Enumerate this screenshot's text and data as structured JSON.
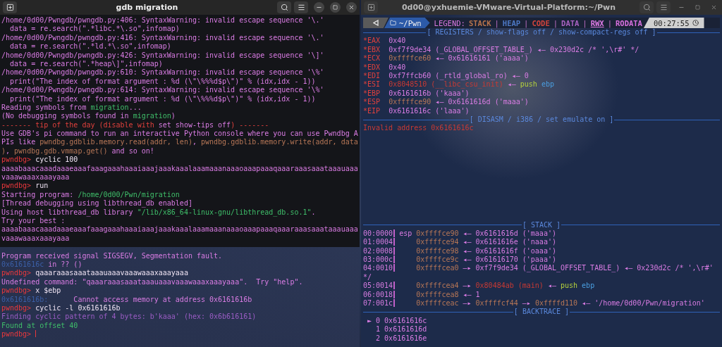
{
  "left_terminal": {
    "title": "gdb migration",
    "focused": true,
    "has_cursor": true,
    "lines": [
      {
        "kind": "output",
        "segments": [
          {
            "kind": "t",
            "text": "/home/0d00/Pwngdb/pwngdb.py:406: SyntaxWarning: invalid escape sequence '\\.'"
          }
        ]
      },
      {
        "kind": "output",
        "segments": [
          {
            "kind": "t",
            "text": "  data = re.search(\".*libc.*\\.so\",infomap)"
          }
        ]
      },
      {
        "kind": "output",
        "segments": [
          {
            "kind": "t",
            "text": "/home/0d00/Pwngdb/pwngdb.py:416: SyntaxWarning: invalid escape sequence '\\.'"
          }
        ]
      },
      {
        "kind": "output",
        "segments": [
          {
            "kind": "t",
            "text": "  data = re.search(\".*ld.*\\.so\",infomap)"
          }
        ]
      },
      {
        "kind": "output",
        "segments": [
          {
            "kind": "t",
            "text": "/home/0d00/Pwngdb/pwngdb.py:426: SyntaxWarning: invalid escape sequence '\\]'"
          }
        ]
      },
      {
        "kind": "output",
        "segments": [
          {
            "kind": "t",
            "text": "  data = re.search(\".*heap\\]\",infomap)"
          }
        ]
      },
      {
        "kind": "output",
        "segments": [
          {
            "kind": "t",
            "text": "/home/0d00/Pwngdb/pwngdb.py:610: SyntaxWarning: invalid escape sequence '\\%'"
          }
        ]
      },
      {
        "kind": "output",
        "segments": [
          {
            "kind": "t",
            "text": "  print(\"The index of format argument : %d (\\\"\\%%%d$p\\\")\" % (idx,idx - 1))"
          }
        ]
      },
      {
        "kind": "output",
        "segments": [
          {
            "kind": "t",
            "text": "/home/0d00/Pwngdb/pwngdb.py:614: SyntaxWarning: invalid escape sequence '\\%'"
          }
        ]
      },
      {
        "kind": "output",
        "segments": [
          {
            "kind": "t",
            "text": "  print(\"The index of format argument : %d (\\\"\\%%%d$p\\\")\" % (idx,idx - 1))"
          }
        ]
      },
      {
        "kind": "output",
        "segments": [
          {
            "kind": "t",
            "text": "Reading symbols from "
          },
          {
            "kind": "g",
            "text": "migration"
          },
          {
            "kind": "t",
            "text": "..."
          }
        ]
      },
      {
        "kind": "output",
        "segments": [
          {
            "kind": "t",
            "text": "(No debugging symbols found in "
          },
          {
            "kind": "g",
            "text": "migration"
          },
          {
            "kind": "t",
            "text": ")"
          }
        ]
      },
      {
        "kind": "output",
        "segments": [
          {
            "kind": "r",
            "text": "------- tip of the day (disable with "
          },
          {
            "kind": "t",
            "text": "set show-tips off"
          },
          {
            "kind": "r",
            "text": ") -------"
          }
        ]
      },
      {
        "kind": "output",
        "segments": [
          {
            "kind": "t",
            "text": "Use GDB's pi command to run an interactive Python console where you can use Pwndbg A"
          }
        ]
      },
      {
        "kind": "output",
        "segments": [
          {
            "kind": "t",
            "text": "PIs like "
          },
          {
            "kind": "o",
            "text": "pwndbg.gdblib.memory.read(addr, len)"
          },
          {
            "kind": "t",
            "text": ", "
          },
          {
            "kind": "o",
            "text": "pwndbg.gdblib.memory.write(addr, data"
          }
        ]
      },
      {
        "kind": "output",
        "segments": [
          {
            "kind": "o",
            "text": ")"
          },
          {
            "kind": "t",
            "text": ", "
          },
          {
            "kind": "o",
            "text": "pwndbg.gdb.vmmap.get()"
          },
          {
            "kind": "t",
            "text": " and so on!"
          }
        ]
      },
      {
        "kind": "output",
        "segments": [
          {
            "kind": "p",
            "text": "pwndbg> "
          },
          {
            "kind": "w",
            "text": "cyclic 100"
          }
        ]
      },
      {
        "kind": "output",
        "segments": [
          {
            "kind": "t",
            "text": "aaaabaaacaaadaaaeaaafaaagaaahaaaiaaajaaakaaalaaamaaanaaaoaaapaaaqaaaraaasaaataaauaaa"
          }
        ]
      },
      {
        "kind": "output",
        "segments": [
          {
            "kind": "t",
            "text": "vaaawaaaxaaayaaa"
          }
        ]
      },
      {
        "kind": "output",
        "segments": [
          {
            "kind": "p",
            "text": "pwndbg> "
          },
          {
            "kind": "w",
            "text": "run"
          }
        ]
      },
      {
        "kind": "output",
        "segments": [
          {
            "kind": "t",
            "text": "Starting program: "
          },
          {
            "kind": "g",
            "text": "/home/0d00/Pwn/migration"
          }
        ]
      },
      {
        "kind": "output",
        "segments": [
          {
            "kind": "t",
            "text": "[Thread debugging using libthread_db enabled]"
          }
        ]
      },
      {
        "kind": "output",
        "segments": [
          {
            "kind": "t",
            "text": "Using host libthread_db library "
          },
          {
            "kind": "g",
            "text": "\"/lib/x86_64-linux-gnu/libthread_db.so.1\""
          },
          {
            "kind": "t",
            "text": "."
          }
        ]
      },
      {
        "kind": "output",
        "segments": [
          {
            "kind": "t",
            "text": "Try your best :"
          }
        ]
      },
      {
        "kind": "output",
        "segments": [
          {
            "kind": "t",
            "text": "aaaabaaacaaadaaaeaaafaaagaaahaaaiaaajaaakaaalaaamaaanaaaoaaapaaaqaaaraaasaaataaauaaa"
          }
        ]
      },
      {
        "kind": "output",
        "segments": [
          {
            "kind": "t",
            "text": "vaaawaaaxaaayaaa"
          }
        ]
      },
      {
        "kind": "blank"
      },
      {
        "kind": "output",
        "segments": [
          {
            "kind": "t",
            "text": "Program received signal SIGSEGV, Segmentation fault."
          }
        ]
      },
      {
        "kind": "output",
        "segments": [
          {
            "kind": "b",
            "text": "0x6161616c"
          },
          {
            "kind": "t",
            "text": " in ?? ()"
          }
        ]
      },
      {
        "kind": "output",
        "segments": [
          {
            "kind": "p",
            "text": "pwndbg> "
          },
          {
            "kind": "w",
            "text": "qaaaraaasaaataaauaaavaaawaaaxaaayaaa"
          }
        ]
      },
      {
        "kind": "output",
        "segments": [
          {
            "kind": "t",
            "text": "Undefined command: \"qaaaraaasaaataaauaaavaaawaaaxaaayaaa\".  Try \"help\"."
          }
        ]
      },
      {
        "kind": "output",
        "segments": [
          {
            "kind": "p",
            "text": "pwndbg> "
          },
          {
            "kind": "w",
            "text": "x $ebp"
          }
        ]
      },
      {
        "kind": "output",
        "segments": [
          {
            "kind": "b",
            "text": "0x6161616b:"
          },
          {
            "kind": "t",
            "text": "      Cannot access memory at address 0x6161616b"
          }
        ]
      },
      {
        "kind": "output",
        "segments": [
          {
            "kind": "p",
            "text": "pwndbg> "
          },
          {
            "kind": "w",
            "text": "cyclic -l 0x6161616b"
          }
        ]
      },
      {
        "kind": "output",
        "segments": [
          {
            "kind": "v",
            "text": "Finding cyclic pattern of 4 bytes: b'kaaa' (hex: 0x6b616161)"
          }
        ]
      },
      {
        "kind": "output",
        "segments": [
          {
            "kind": "g",
            "text": "Found at offset 40"
          }
        ]
      },
      {
        "kind": "output",
        "segments": [
          {
            "kind": "p",
            "text": "pwndbg> "
          }
        ]
      }
    ]
  },
  "right_terminal": {
    "title": "0d00@yxhuemie-VMware-Virtual-Platform:~/Pwn",
    "focused": false,
    "status_bar": {
      "path": "~/Pwn",
      "legend_label": "LEGEND:",
      "separator": "|",
      "time": "00:27:55",
      "legend": [
        {
          "label": "STACK",
          "color": "#b8744c",
          "underlined": false
        },
        {
          "label": "HEAP",
          "color": "#4d78c4",
          "underlined": false
        },
        {
          "label": "CODE",
          "color": "#d0443c",
          "underlined": false
        },
        {
          "label": "DATA",
          "color": "#a862c0",
          "underlined": false
        },
        {
          "label": "RWX",
          "color": "#e07ce8",
          "underlined": true
        },
        {
          "label": "RODATA",
          "color": "#d870e0",
          "underlined": false
        }
      ]
    },
    "top_lines": [
      {
        "kind": "header",
        "title": "[ REGISTERS / show-flags off / show-compact-regs off ]"
      },
      {
        "kind": "output",
        "segments": [
          {
            "kind": "r",
            "text": "*EAX"
          },
          {
            "kind": "t",
            "text": "  0x40"
          }
        ]
      },
      {
        "kind": "output",
        "segments": [
          {
            "kind": "r",
            "text": "*EBX"
          },
          {
            "kind": "t",
            "text": "  0xf7f9de34 (_GLOBAL_OFFSET_TABLE_) ◂— 0x230d2c /* ',\\r#' */"
          }
        ]
      },
      {
        "kind": "output",
        "segments": [
          {
            "kind": "r",
            "text": "*ECX"
          },
          {
            "kind": "o",
            "text": "  0xffffce60"
          },
          {
            "kind": "t",
            "text": " ◂— 0x61616161 ('aaaa')"
          }
        ]
      },
      {
        "kind": "output",
        "segments": [
          {
            "kind": "r",
            "text": "*EDX"
          },
          {
            "kind": "t",
            "text": "  0x40"
          }
        ]
      },
      {
        "kind": "output",
        "segments": [
          {
            "kind": "r",
            "text": "*EDI"
          },
          {
            "kind": "t",
            "text": "  0xf7ffcb60 (_rtld_global_ro) ◂— 0"
          }
        ]
      },
      {
        "kind": "output",
        "segments": [
          {
            "kind": "r",
            "text": "*ESI"
          },
          {
            "kind": "k",
            "text": "  0x8048510 (__libc_csu_init)"
          },
          {
            "kind": "t",
            "text": " ◂— "
          },
          {
            "kind": "y",
            "text": "push "
          },
          {
            "kind": "c",
            "text": "ebp"
          }
        ]
      },
      {
        "kind": "output",
        "segments": [
          {
            "kind": "r",
            "text": "*EBP"
          },
          {
            "kind": "t",
            "text": "  0x6161616b ('kaaa')"
          }
        ]
      },
      {
        "kind": "output",
        "segments": [
          {
            "kind": "r",
            "text": "*ESP"
          },
          {
            "kind": "o",
            "text": "  0xffffce90"
          },
          {
            "kind": "t",
            "text": " ◂— 0x6161616d ('maaa')"
          }
        ]
      },
      {
        "kind": "output",
        "segments": [
          {
            "kind": "r",
            "text": "*EIP"
          },
          {
            "kind": "t",
            "text": "  0x6161616c ('laaa')"
          }
        ]
      },
      {
        "kind": "header",
        "title": "[ DISASM / i386 / set emulate on ]"
      },
      {
        "kind": "output",
        "segments": [
          {
            "kind": "k",
            "text": "Invalid address 0x6161616c"
          }
        ]
      }
    ],
    "bottom_lines": [
      {
        "kind": "header",
        "title": "[ STACK ]"
      },
      {
        "kind": "output",
        "segments": [
          {
            "kind": "n",
            "text": "00:0000"
          },
          {
            "kind": "t",
            "text": " esp "
          },
          {
            "kind": "o",
            "text": "0xffffce90"
          },
          {
            "kind": "t",
            "text": " ◂— 0x6161616d ('maaa')"
          }
        ]
      },
      {
        "kind": "output",
        "segments": [
          {
            "kind": "n",
            "text": "01:0004"
          },
          {
            "kind": "o",
            "text": "     0xffffce94"
          },
          {
            "kind": "t",
            "text": " ◂— 0x6161616e ('naaa')"
          }
        ]
      },
      {
        "kind": "output",
        "segments": [
          {
            "kind": "n",
            "text": "02:0008"
          },
          {
            "kind": "o",
            "text": "     0xffffce98"
          },
          {
            "kind": "t",
            "text": " ◂— 0x6161616f ('oaaa')"
          }
        ]
      },
      {
        "kind": "output",
        "segments": [
          {
            "kind": "n",
            "text": "03:000c"
          },
          {
            "kind": "o",
            "text": "     0xffffce9c"
          },
          {
            "kind": "t",
            "text": " ◂— 0x61616170 ('paaa')"
          }
        ]
      },
      {
        "kind": "output",
        "segments": [
          {
            "kind": "n",
            "text": "04:0010"
          },
          {
            "kind": "o",
            "text": "     0xffffcea0"
          },
          {
            "kind": "t",
            "text": " —▸ 0xf7f9de34 (_GLOBAL_OFFSET_TABLE_) ◂— 0x230d2c /* ',\\r#'"
          }
        ]
      },
      {
        "kind": "output",
        "segments": [
          {
            "kind": "t",
            "text": "*/"
          }
        ]
      },
      {
        "kind": "output",
        "segments": [
          {
            "kind": "n",
            "text": "05:0014"
          },
          {
            "kind": "o",
            "text": "     0xffffcea4"
          },
          {
            "kind": "t",
            "text": " —▸ "
          },
          {
            "kind": "k",
            "text": "0x80484ab (main)"
          },
          {
            "kind": "t",
            "text": " ◂— "
          },
          {
            "kind": "y",
            "text": "push "
          },
          {
            "kind": "c",
            "text": "ebp"
          }
        ]
      },
      {
        "kind": "output",
        "segments": [
          {
            "kind": "n",
            "text": "06:0018"
          },
          {
            "kind": "o",
            "text": "     0xffffcea8"
          },
          {
            "kind": "t",
            "text": " ◂— 1"
          }
        ]
      },
      {
        "kind": "output",
        "segments": [
          {
            "kind": "n",
            "text": "07:001c"
          },
          {
            "kind": "o",
            "text": "     0xffffceac"
          },
          {
            "kind": "t",
            "text": " —▸ "
          },
          {
            "kind": "o",
            "text": "0xffffcf44"
          },
          {
            "kind": "t",
            "text": " —▸ "
          },
          {
            "kind": "o",
            "text": "0xffffd110"
          },
          {
            "kind": "t",
            "text": " ◂— '/home/0d00/Pwn/migration'"
          }
        ]
      },
      {
        "kind": "header",
        "title": "[ BACKTRACE ]"
      },
      {
        "kind": "output",
        "segments": [
          {
            "kind": "t",
            "text": " ► 0 0x6161616c"
          }
        ]
      },
      {
        "kind": "output",
        "segments": [
          {
            "kind": "t",
            "text": "   1 0x6161616d"
          }
        ]
      },
      {
        "kind": "output",
        "segments": [
          {
            "kind": "t",
            "text": "   2 0x6161616e"
          }
        ]
      }
    ]
  }
}
